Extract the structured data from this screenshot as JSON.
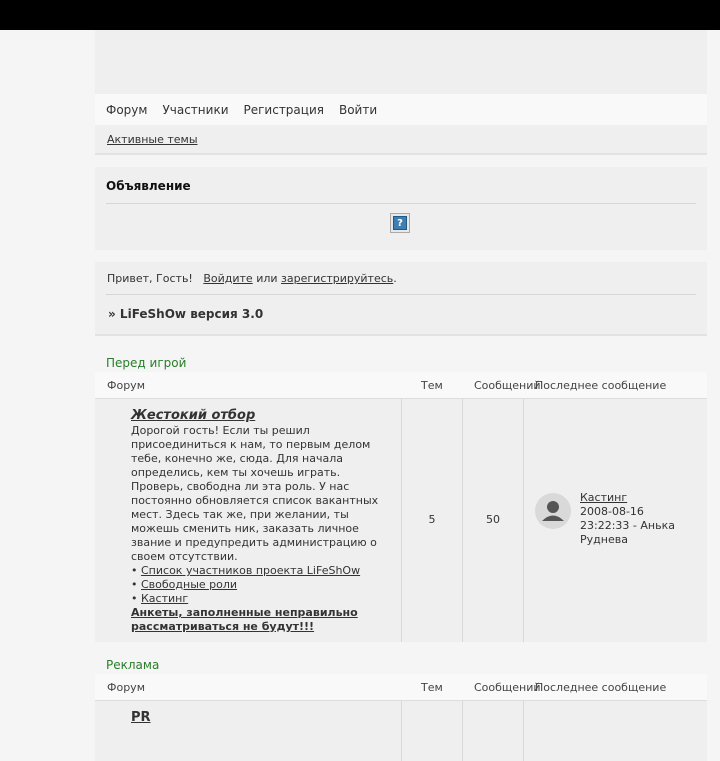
{
  "nav": [
    "Форум",
    "Участники",
    "Регистрация",
    "Войти"
  ],
  "subnav": {
    "active_topics": "Активные темы"
  },
  "announcement": {
    "title": "Объявление",
    "image_placeholder": "?"
  },
  "welcome": {
    "greeting": "Привет, Гость!",
    "login": "Войдите",
    "or": "или",
    "register": "зарегистрируйтесь",
    "period": ".",
    "breadcrumb": "» LiFeShOw версия 3.0"
  },
  "columns": {
    "forum": "Форум",
    "topics": "Тем",
    "posts": "Сообщений",
    "last": "Последнее сообщение"
  },
  "categories": [
    {
      "title": "Перед игрой",
      "forum": {
        "name": "Жестокий отбор",
        "description": "Дорогой гость! Если ты решил присоединиться к нам, то первым делом тебе, конечно же, сюда. Для начала определись, кем ты хочешь играть. Проверь, свободна ли эта роль. У нас постоянно обновляется список вакантных мест. Здесь так же, при желании, ты можешь сменить ник, заказать личное звание и предупредить администрацию о своем отсутствии.",
        "bullet": "•",
        "links": [
          "Список участников проекта LiFeShOw",
          "Свободные роли",
          "Кастинг"
        ],
        "warning": "Анкеты, заполненные неправильно рассматриваться не будут!!!",
        "topics": "5",
        "posts": "50",
        "last_topic": "Кастинг",
        "last_date": "2008-08-16 23:22:33",
        "last_author": "- Анька Руднева"
      }
    },
    {
      "title": "Реклама",
      "forum": {
        "name": "PR"
      }
    }
  ],
  "icons": {
    "avatar": "user-avatar-icon",
    "image": "broken-image-icon"
  },
  "colors": {
    "category_title": "#2a7d2a",
    "header_bar": "#000000"
  }
}
